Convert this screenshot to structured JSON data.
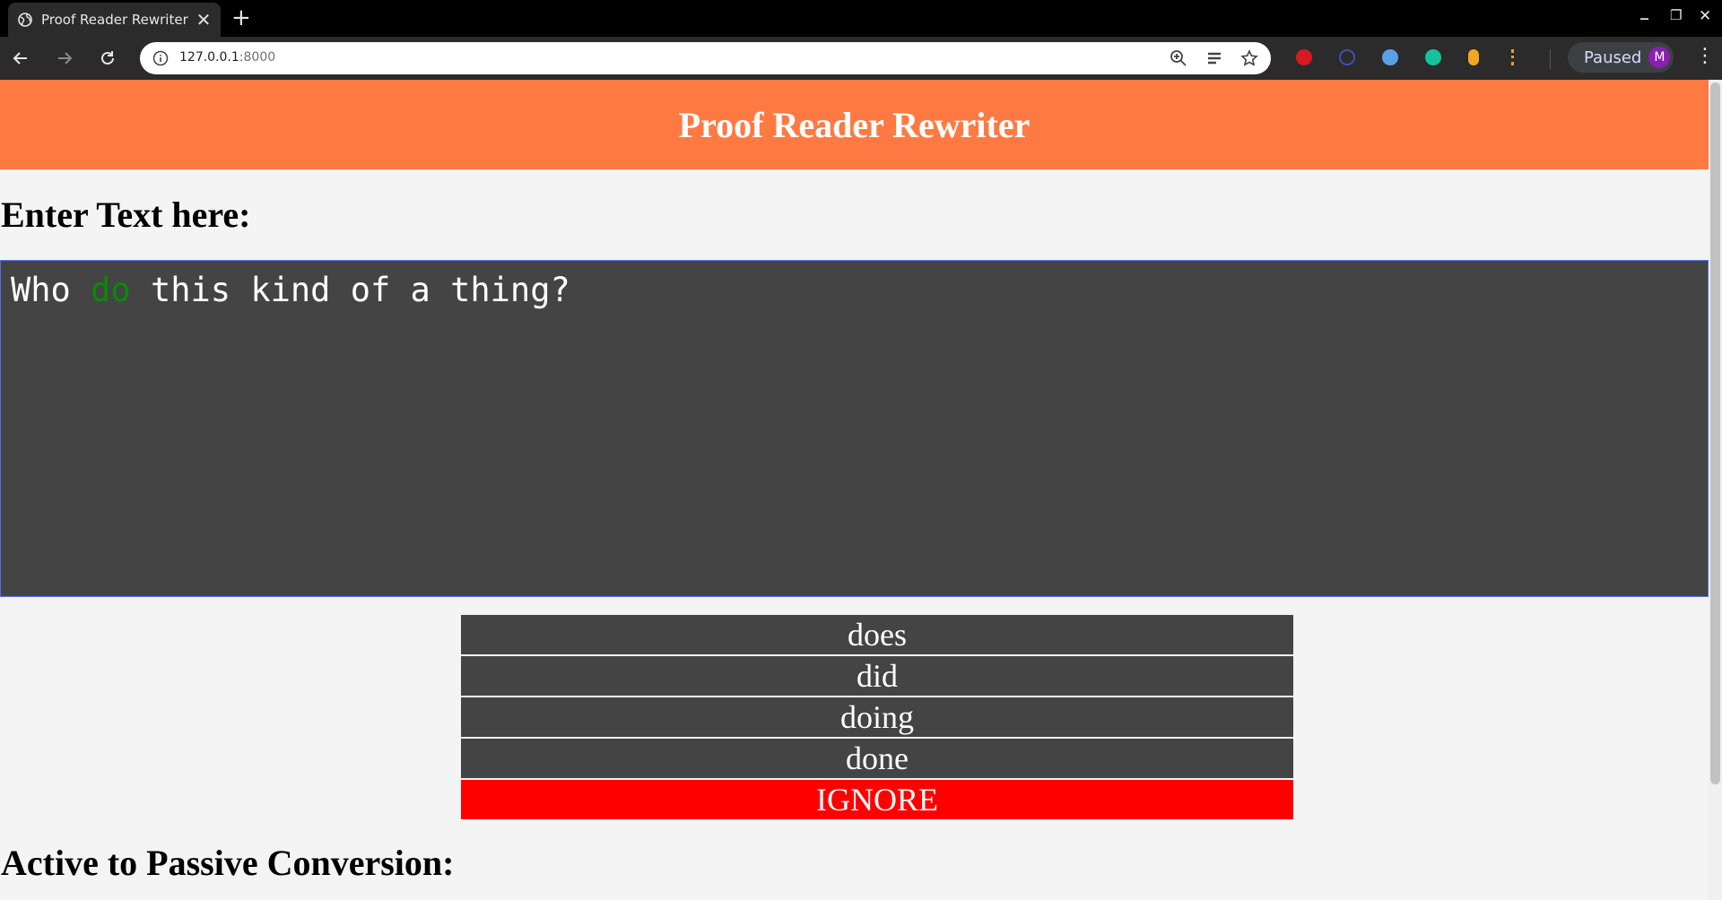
{
  "browser": {
    "tab_title": "Proof Reader Rewriter",
    "tab_close": "✕",
    "new_tab": "+",
    "url_host": "127.0.0.1",
    "url_port": ":8000",
    "profile_status": "Paused",
    "profile_initial": "M",
    "window_min": "_",
    "window_max": "❐",
    "window_close": "✕",
    "menu": "⋮"
  },
  "page": {
    "title": "Proof Reader Rewriter",
    "enter_label": "Enter Text here:",
    "editor": {
      "before": "Who ",
      "highlight": "do",
      "after": " this kind of a thing?"
    },
    "suggestions": [
      "does",
      "did",
      "doing",
      "done"
    ],
    "ignore_label": "IGNORE",
    "passive_label": "Active to Passive Conversion:"
  },
  "colors": {
    "header": "#ff7a43",
    "editor_bg": "#444444",
    "highlight": "#0a8a0a",
    "ignore": "#ff0000"
  }
}
